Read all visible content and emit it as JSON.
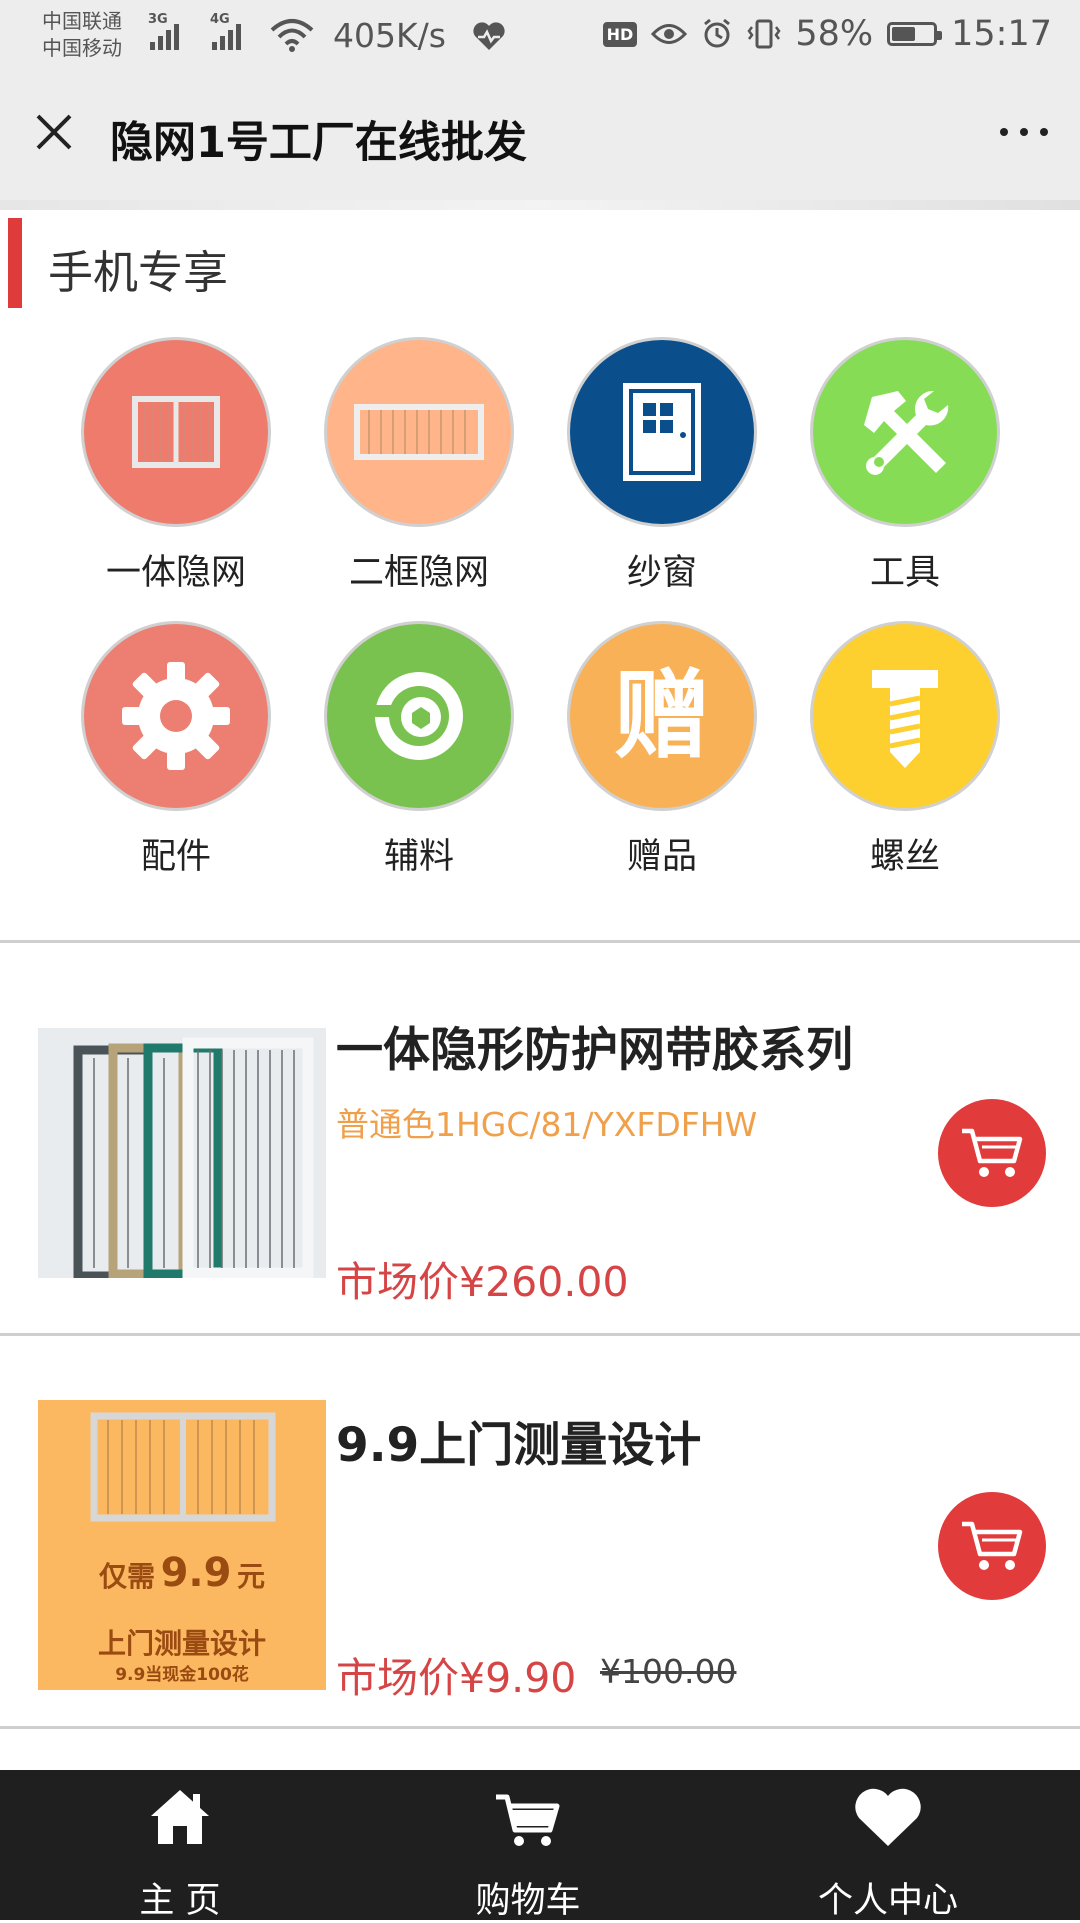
{
  "status_bar": {
    "carrier1": "中国联通",
    "carrier2": "中国移动",
    "net1": "3G",
    "net2": "4G",
    "speed": "405K/s",
    "hd": "HD",
    "battery": "58%",
    "battery_level": 0.58,
    "time": "15:17"
  },
  "title_bar": {
    "title": "隐网1号工厂在线批发"
  },
  "section": {
    "title": "手机专享"
  },
  "categories": [
    {
      "label": "一体隐网",
      "color": "#ee7b6b",
      "icon": "window-frame-icon"
    },
    {
      "label": "二框隐网",
      "color": "#ffb48a",
      "icon": "window-frame-icon"
    },
    {
      "label": "纱窗",
      "color": "#0a4e8c",
      "icon": "window-icon"
    },
    {
      "label": "工具",
      "color": "#86dd55",
      "icon": "tools-icon"
    },
    {
      "label": "配件",
      "color": "#ec7f72",
      "icon": "gear-icon"
    },
    {
      "label": "辅料",
      "color": "#79c24f",
      "icon": "roll-icon"
    },
    {
      "label": "赠品",
      "color": "#f8b157",
      "icon": "gift-char-icon"
    },
    {
      "label": "螺丝",
      "color": "#fdcf2f",
      "icon": "screw-icon"
    }
  ],
  "gift_char": "赠",
  "products": [
    {
      "title": "一体隐形防护网带胶系列",
      "subtitle": "普通色1HGC/81/YXFDFHW",
      "price": "市场价¥260.00",
      "old_price": ""
    },
    {
      "title": "9.9上门测量设计",
      "subtitle": "",
      "price": "市场价¥9.90",
      "old_price": "¥100.00",
      "image_text": {
        "line1_prefix": "仅需",
        "line1_amount": "9.9",
        "line1_suffix": "元",
        "line2": "上门测量设计",
        "line3": "9.9当现金100花"
      }
    }
  ],
  "bottom_nav": [
    {
      "label": "主 页",
      "icon": "home-icon"
    },
    {
      "label": "购物车",
      "icon": "cart-icon"
    },
    {
      "label": "个人中心",
      "icon": "heart-icon"
    }
  ]
}
